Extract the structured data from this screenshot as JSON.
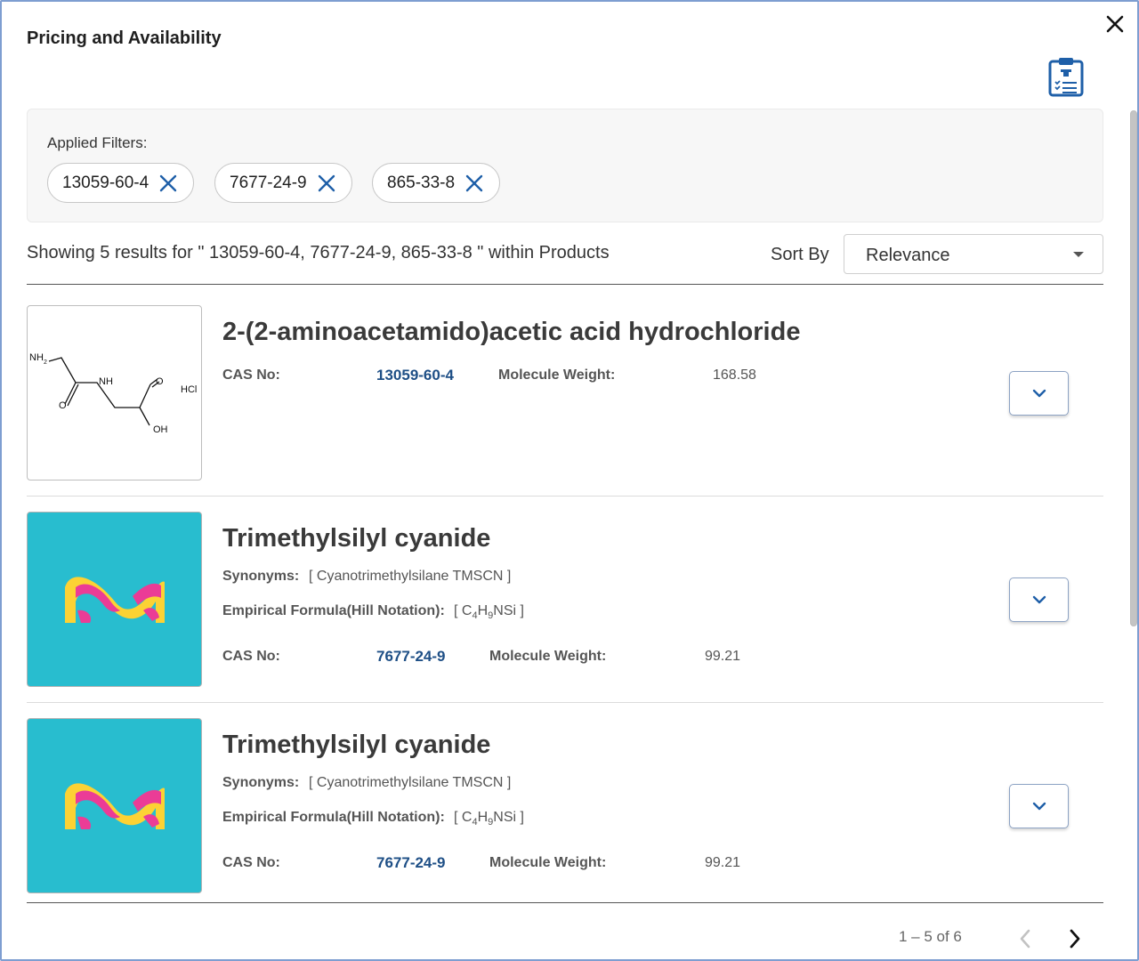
{
  "dialog": {
    "title": "Pricing and Availability"
  },
  "filters": {
    "label": "Applied Filters:",
    "chips": [
      "13059-60-4",
      "7677-24-9",
      "865-33-8"
    ]
  },
  "results": {
    "summary": "Showing 5 results for \" 13059-60-4, 7677-24-9, 865-33-8 \" within Products",
    "sort_label": "Sort By",
    "sort_value": "Relevance"
  },
  "labels": {
    "cas": "CAS No:",
    "mw": "Molecule Weight:",
    "synonyms": "Synonyms:",
    "formula": "Empirical Formula(Hill Notation):"
  },
  "structure_labels": {
    "nh2": "NH",
    "nh2_sub": "2",
    "nh": "NH",
    "o_top": "O",
    "o_bottom": "O",
    "oh": "OH",
    "hcl": "HCl"
  },
  "products": [
    {
      "name": "2-(2-aminoacetamido)acetic acid hydrochloride",
      "cas": "13059-60-4",
      "mw": "168.58"
    },
    {
      "name": "Trimethylsilyl cyanide",
      "synonyms": "[ Cyanotrimethylsilane TMSCN ]",
      "formula": {
        "open": "[ C",
        "s1": "4",
        "m1": "H",
        "s2": "9",
        "m2": "NSi ]"
      },
      "cas": "7677-24-9",
      "mw": "99.21"
    },
    {
      "name": "Trimethylsilyl cyanide",
      "synonyms": "[ Cyanotrimethylsilane TMSCN ]",
      "formula": {
        "open": "[ C",
        "s1": "4",
        "m1": "H",
        "s2": "9",
        "m2": "NSi ]"
      },
      "cas": "7677-24-9",
      "mw": "99.21"
    }
  ],
  "pagination": {
    "range": "1 – 5 of 6"
  },
  "colors": {
    "link": "#1e4f86",
    "icon_blue": "#1e5fa8",
    "logo_bg": "#28bdcf",
    "logo_yellow": "#fcd234",
    "logo_pink": "#eb3c96"
  },
  "icons": [
    "close-icon",
    "clipboard-list-icon",
    "chip-remove-icon",
    "caret-down-icon",
    "chevron-down-icon",
    "chevron-left-icon",
    "chevron-right-icon"
  ]
}
